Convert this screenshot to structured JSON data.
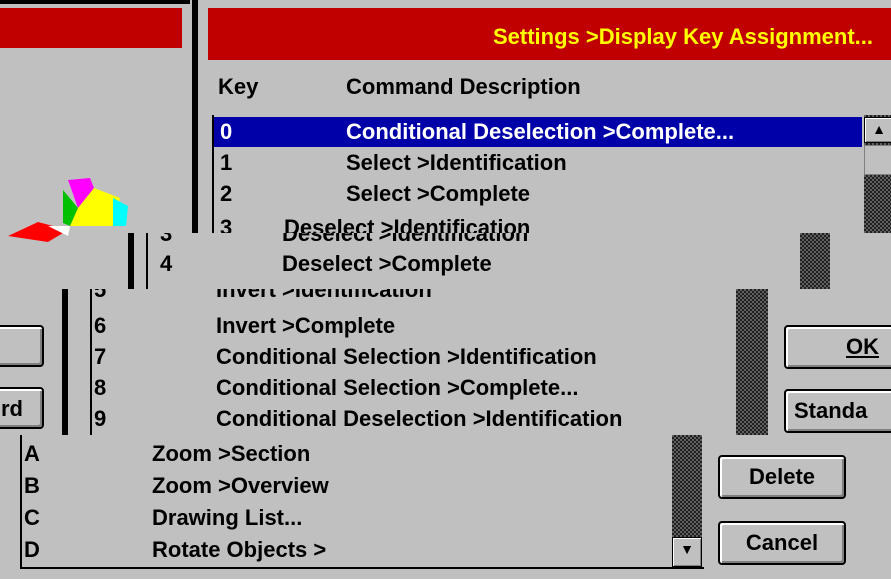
{
  "dialog_title": "Settings >Display Key Assignment...",
  "headers": {
    "key": "Key",
    "command": "Command Description"
  },
  "rows": [
    {
      "key": "0",
      "command": "Conditional Deselection >Complete..."
    },
    {
      "key": "1",
      "command": "Select >Identification"
    },
    {
      "key": "2",
      "command": "Select >Complete"
    },
    {
      "key": "3",
      "command": "Deselect >Identification"
    },
    {
      "key": "4",
      "command": "Deselect >Complete"
    },
    {
      "key": "5",
      "command": "Invert >Identification"
    },
    {
      "key": "6",
      "command": "Invert >Complete"
    },
    {
      "key": "7",
      "command": "Conditional Selection >Identification"
    },
    {
      "key": "8",
      "command": "Conditional Selection >Complete..."
    },
    {
      "key": "9",
      "command": "Conditional Deselection >Identification"
    },
    {
      "key": "A",
      "command": "Zoom >Section"
    },
    {
      "key": "B",
      "command": "Zoom >Overview"
    },
    {
      "key": "C",
      "command": "Drawing List..."
    },
    {
      "key": "D",
      "command": "Rotate Objects >"
    }
  ],
  "buttons": {
    "ok": "OK",
    "standard": "Standa",
    "delete": "Delete",
    "cancel": "Cancel",
    "left_partial": "rd"
  },
  "scroll_up_glyph": "▲",
  "scroll_down_glyph": "▼",
  "colors": {
    "title_bg": "#c00000",
    "title_text": "#ffff00",
    "selection": "#0000a8"
  }
}
